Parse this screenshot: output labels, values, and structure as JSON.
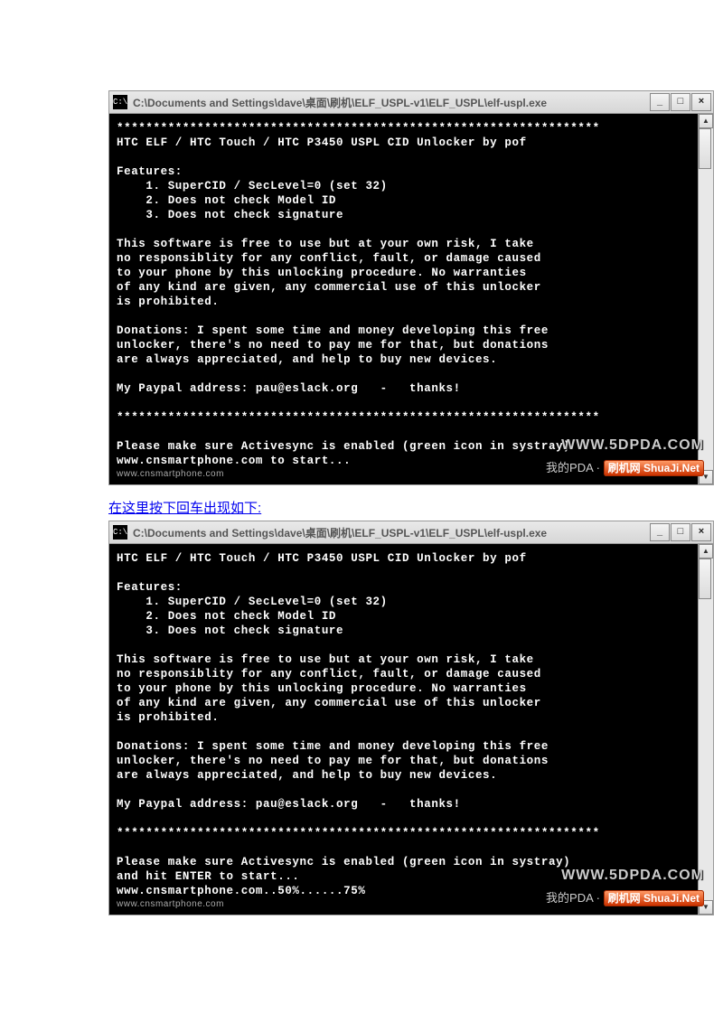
{
  "window1": {
    "icon_label": "C:\\",
    "title": "C:\\Documents and Settings\\dave\\桌面\\刷机\\ELF_USPL-v1\\ELF_USPL\\elf-uspl.exe",
    "btn_min": "_",
    "btn_max": "□",
    "btn_close": "×",
    "scroll_up": "▲",
    "scroll_down": "▼",
    "lines": "******************************************************************\nHTC ELF / HTC Touch / HTC P3450 USPL CID Unlocker by pof\n\nFeatures:\n    1. SuperCID / SecLevel=0 (set 32)\n    2. Does not check Model ID\n    3. Does not check signature\n\nThis software is free to use but at your own risk, I take\nno responsiblity for any conflict, fault, or damage caused\nto your phone by this unlocking procedure. No warranties\nof any kind are given, any commercial use of this unlocker\nis prohibited.\n\nDonations: I spent some time and money developing this free\nunlocker, there's no need to pay me for that, but donations\nare always appreciated, and help to buy new devices.\n\nMy Paypal address: pau@eslack.org   -   thanks!\n\n******************************************************************\n\nPlease make sure Activesync is enabled (green icon in systray)\nwww.cnsmartphone.com to start...",
    "wm1": "WWW.5DPDA.COM",
    "wm2_cn": "我的PDA · ",
    "wm2_zh": "刷机网",
    "wm2_en": "ShuaJi.Net",
    "wm3": "www.cnsmartphone.com"
  },
  "instruction": "在这里按下回车出现如下:",
  "window2": {
    "icon_label": "C:\\",
    "title": "C:\\Documents and Settings\\dave\\桌面\\刷机\\ELF_USPL-v1\\ELF_USPL\\elf-uspl.exe",
    "btn_min": "_",
    "btn_max": "□",
    "btn_close": "×",
    "scroll_up": "▲",
    "scroll_down": "▼",
    "lines": "HTC ELF / HTC Touch / HTC P3450 USPL CID Unlocker by pof\n\nFeatures:\n    1. SuperCID / SecLevel=0 (set 32)\n    2. Does not check Model ID\n    3. Does not check signature\n\nThis software is free to use but at your own risk, I take\nno responsiblity for any conflict, fault, or damage caused\nto your phone by this unlocking procedure. No warranties\nof any kind are given, any commercial use of this unlocker\nis prohibited.\n\nDonations: I spent some time and money developing this free\nunlocker, there's no need to pay me for that, but donations\nare always appreciated, and help to buy new devices.\n\nMy Paypal address: pau@eslack.org   -   thanks!\n\n******************************************************************\n\nPlease make sure Activesync is enabled (green icon in systray)\nand hit ENTER to start...\nwww.cnsmartphone.com..50%......75%",
    "wm1": "WWW.5DPDA.COM",
    "wm2_cn": "我的PDA · ",
    "wm2_zh": "刷机网",
    "wm2_en": "ShuaJi.Net",
    "wm3": "www.cnsmartphone.com"
  }
}
